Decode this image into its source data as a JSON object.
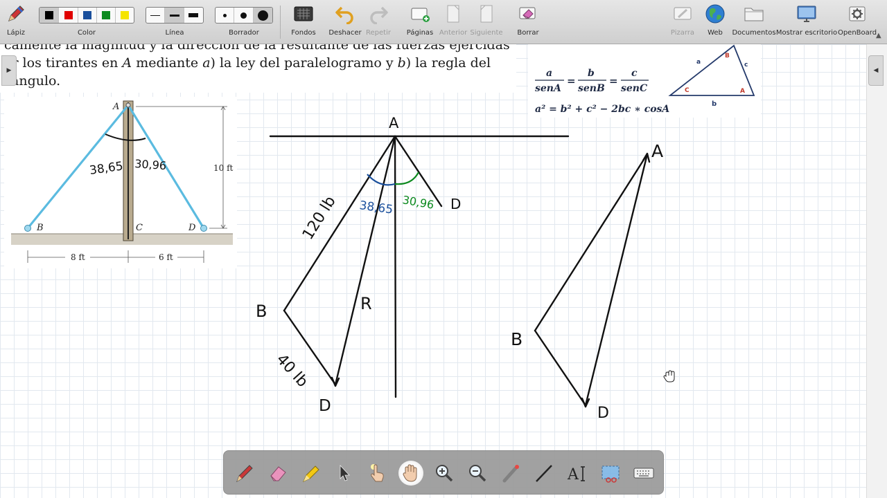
{
  "toolbar": {
    "pen": "Lápiz",
    "color": "Color",
    "line": "Línea",
    "eraser": "Borrador",
    "backgrounds": "Fondos",
    "undo": "Deshacer",
    "redo": "Repetir",
    "pages": "Páginas",
    "previous": "Anterior",
    "next": "Siguiente",
    "erase": "Borrar",
    "board": "Pizarra",
    "web": "Web",
    "documents": "Documentos",
    "show_desktop": "Mostrar escritorio",
    "openboard": "OpenBoard",
    "colors": [
      "#000000",
      "#e00000",
      "#1a4f9c",
      "#0d8a1f",
      "#f5e400"
    ],
    "selected_color": "#000000"
  },
  "textbook": {
    "line1": "camente la magnitud y la dirección de la resultante de las fuerzas ejercidas",
    "line2_a": "or los tirantes en ",
    "line2_A": "A",
    "line2_b": " mediante ",
    "line2_ia": "a",
    "line2_c": ") la ley del paralelogramo y ",
    "line2_ib": "b",
    "line2_d": ") la regla del",
    "line3": "ángulo."
  },
  "figure": {
    "label_A": "A",
    "label_B": "B",
    "label_C": "C",
    "label_D": "D",
    "height": "10 ft",
    "left_dist": "8 ft",
    "right_dist": "6 ft",
    "angle_left": "38,65",
    "angle_right": "30,96"
  },
  "formula": {
    "a": "a",
    "b": "b",
    "c": "c",
    "senA": "senA",
    "senB": "senB",
    "senC": "senC",
    "cosine_law": "a² = b² + c² − 2bc ∗ cosA",
    "tri_A": "A",
    "tri_B": "B",
    "tri_C": "C",
    "tri_a": "a",
    "tri_b": "b",
    "tri_c": "c"
  },
  "handwriting": {
    "A1": "A",
    "D1": "D",
    "force1": "120 lb",
    "angle_left": "38,65",
    "angle_right": "30,96",
    "B1": "B",
    "R": "R",
    "force2": "40 lb",
    "D2": "D",
    "A2": "A",
    "B2": "B",
    "D3": "D"
  },
  "ink_colors": {
    "black": "#111111",
    "blue": "#1a4f9c",
    "green": "#0d8a1f",
    "cable": "#5bbbe0"
  }
}
